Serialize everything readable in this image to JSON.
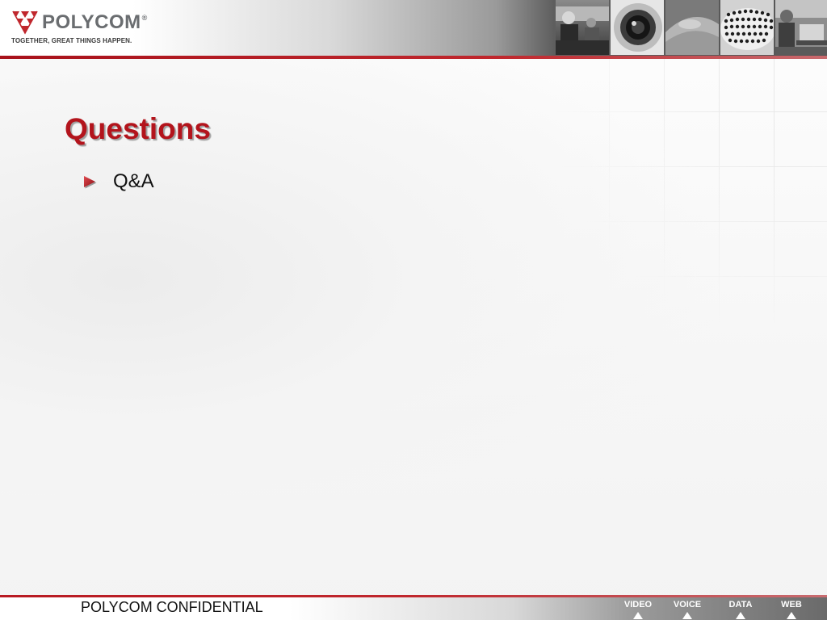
{
  "header": {
    "logo": {
      "wordmark": "POLYCOM",
      "trademark": "®",
      "tagline": "TOGETHER, GREAT THINGS HAPPEN.",
      "icon": "polycom-triangle-logo-icon"
    },
    "photos": [
      {
        "name": "people-photo"
      },
      {
        "name": "camera-lens-photo"
      },
      {
        "name": "conference-phone-photo"
      },
      {
        "name": "speaker-grille-photo"
      },
      {
        "name": "laptop-user-photo"
      }
    ]
  },
  "slide": {
    "title": "Questions",
    "bullets": [
      {
        "text": "Q&A",
        "icon": "red-triangle-bullet-icon"
      }
    ]
  },
  "footer": {
    "confidential": "POLYCOM CONFIDENTIAL",
    "nav": [
      {
        "label": "VIDEO"
      },
      {
        "label": "VOICE"
      },
      {
        "label": "DATA"
      },
      {
        "label": "WEB"
      }
    ]
  },
  "colors": {
    "accent_red": "#b3141c",
    "rule_red": "#c0272d",
    "logo_gray": "#6a6d70"
  }
}
